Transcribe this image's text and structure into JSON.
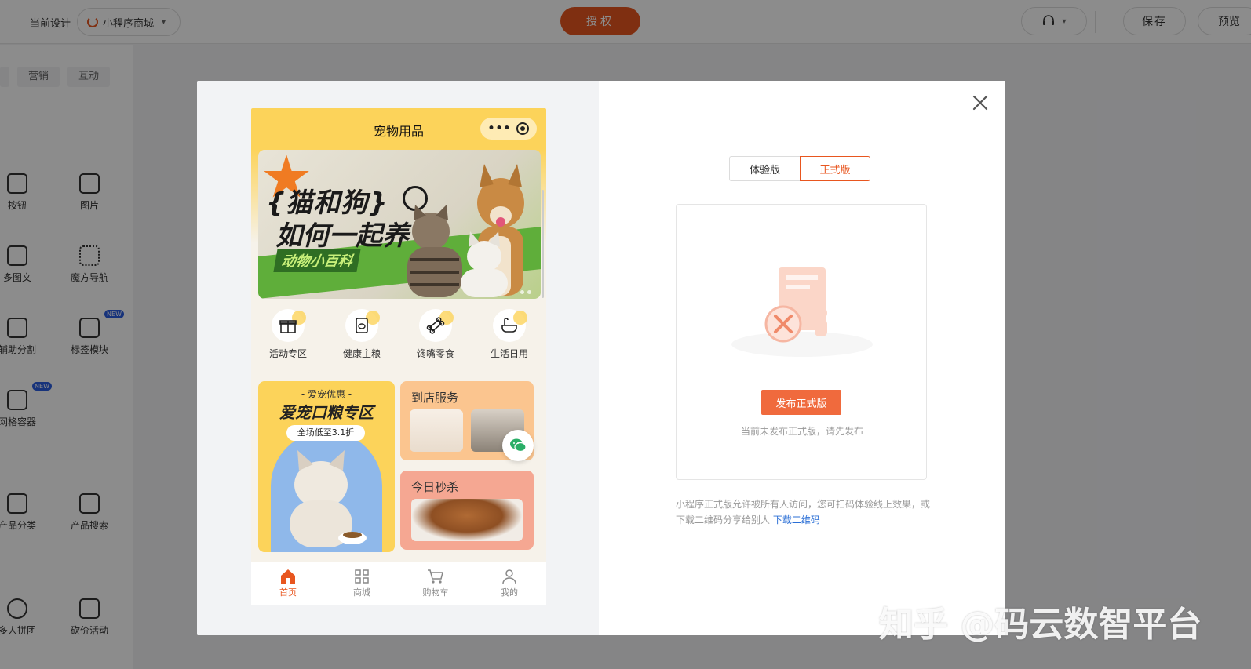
{
  "topbar": {
    "design_label": "当前设计",
    "design_name": "小程序商城",
    "auth_label": "授权",
    "save_label": "保存",
    "preview_label": "预览"
  },
  "left_panel": {
    "tabs": [
      "营销",
      "互动"
    ],
    "components": [
      {
        "label": "按钮",
        "icon": "button-icon"
      },
      {
        "label": "图片",
        "icon": "image-icon"
      },
      {
        "label": "多图文",
        "icon": "multi-image-icon"
      },
      {
        "label": "魔方导航",
        "icon": "grid-nav-icon"
      },
      {
        "label": "辅助分割",
        "icon": "divider-icon"
      },
      {
        "label": "标签模块",
        "icon": "tag-module-icon",
        "badge": "NEW"
      },
      {
        "label": "网格容器",
        "icon": "grid-container-icon",
        "badge": "NEW"
      },
      {
        "label": "产品分类",
        "icon": "category-icon"
      },
      {
        "label": "产品搜索",
        "icon": "product-search-icon"
      },
      {
        "label": "多人拼团",
        "icon": "group-buy-icon"
      },
      {
        "label": "砍价活动",
        "icon": "bargain-icon"
      }
    ]
  },
  "phone": {
    "title": "宠物用品",
    "banner": {
      "line1": "{猫和狗}",
      "line2": "如何一起养",
      "tag": "动物小百科"
    },
    "nav": [
      {
        "label": "活动专区",
        "icon": "gift-icon"
      },
      {
        "label": "健康主粮",
        "icon": "pet-food-icon"
      },
      {
        "label": "馋嘴零食",
        "icon": "bone-icon"
      },
      {
        "label": "生活日用",
        "icon": "bathtub-icon"
      }
    ],
    "promo_big": {
      "sub": "- 爱宠优惠 -",
      "title": "爱宠口粮专区",
      "pill": "全场低至3.1折"
    },
    "promo_store": "到店服务",
    "promo_flash": "今日秒杀",
    "tabbar": [
      {
        "label": "首页",
        "icon": "home-icon"
      },
      {
        "label": "商城",
        "icon": "mall-icon"
      },
      {
        "label": "购物车",
        "icon": "cart-icon"
      },
      {
        "label": "我的",
        "icon": "user-icon"
      }
    ]
  },
  "release": {
    "tab_trial": "体验版",
    "tab_official": "正式版",
    "publish_label": "发布正式版",
    "empty_tip": "当前未发布正式版，请先发布",
    "description": "小程序正式版允许被所有人访问，您可扫码体验线上效果，或下载二维码分享给别人",
    "download_link": "下载二维码"
  },
  "watermark": "知乎 @码云数智平台",
  "colors": {
    "brand": "#e8561f",
    "phone_theme": "#fcd35a",
    "link": "#2b6fd6"
  }
}
